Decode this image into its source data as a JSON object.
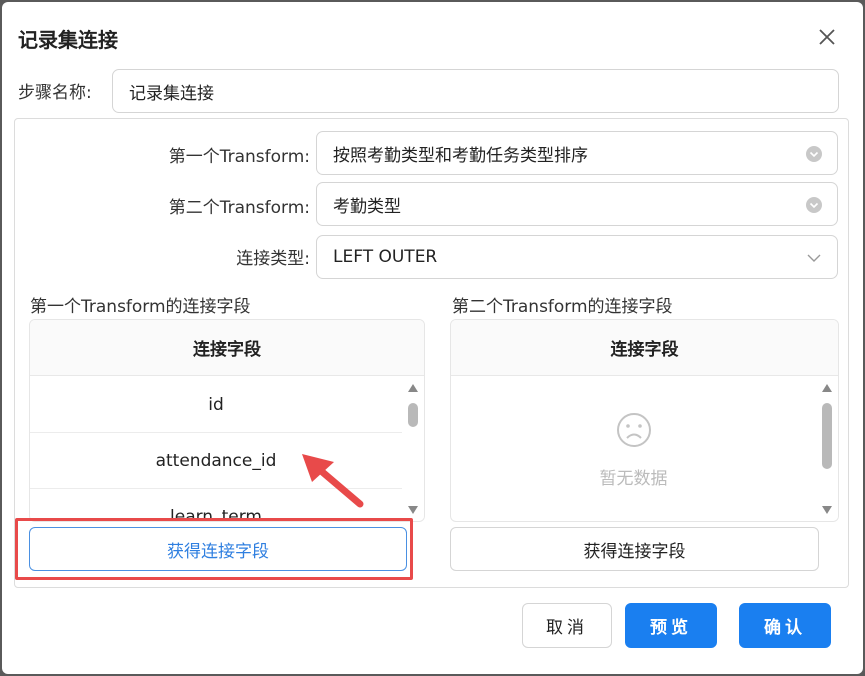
{
  "dialog": {
    "title": "记录集连接"
  },
  "step": {
    "label": "步骤名称:",
    "value": "记录集连接"
  },
  "form": {
    "first_transform_label": "第一个Transform:",
    "first_transform_value": "按照考勤类型和考勤任务类型排序",
    "second_transform_label": "第二个Transform:",
    "second_transform_value": "考勤类型",
    "join_type_label": "连接类型:",
    "join_type_value": "LEFT OUTER"
  },
  "left_table": {
    "section_title": "第一个Transform的连接字段",
    "header": "连接字段",
    "rows": [
      "id",
      "attendance_id",
      "learn_term"
    ],
    "button": "获得连接字段"
  },
  "right_table": {
    "section_title": "第二个Transform的连接字段",
    "header": "连接字段",
    "empty_text": "暂无数据",
    "button": "获得连接字段"
  },
  "footer": {
    "cancel": "取消",
    "preview": "预览",
    "confirm": "确认"
  },
  "colors": {
    "primary": "#1a7ff0",
    "highlight": "#e84a4a"
  }
}
